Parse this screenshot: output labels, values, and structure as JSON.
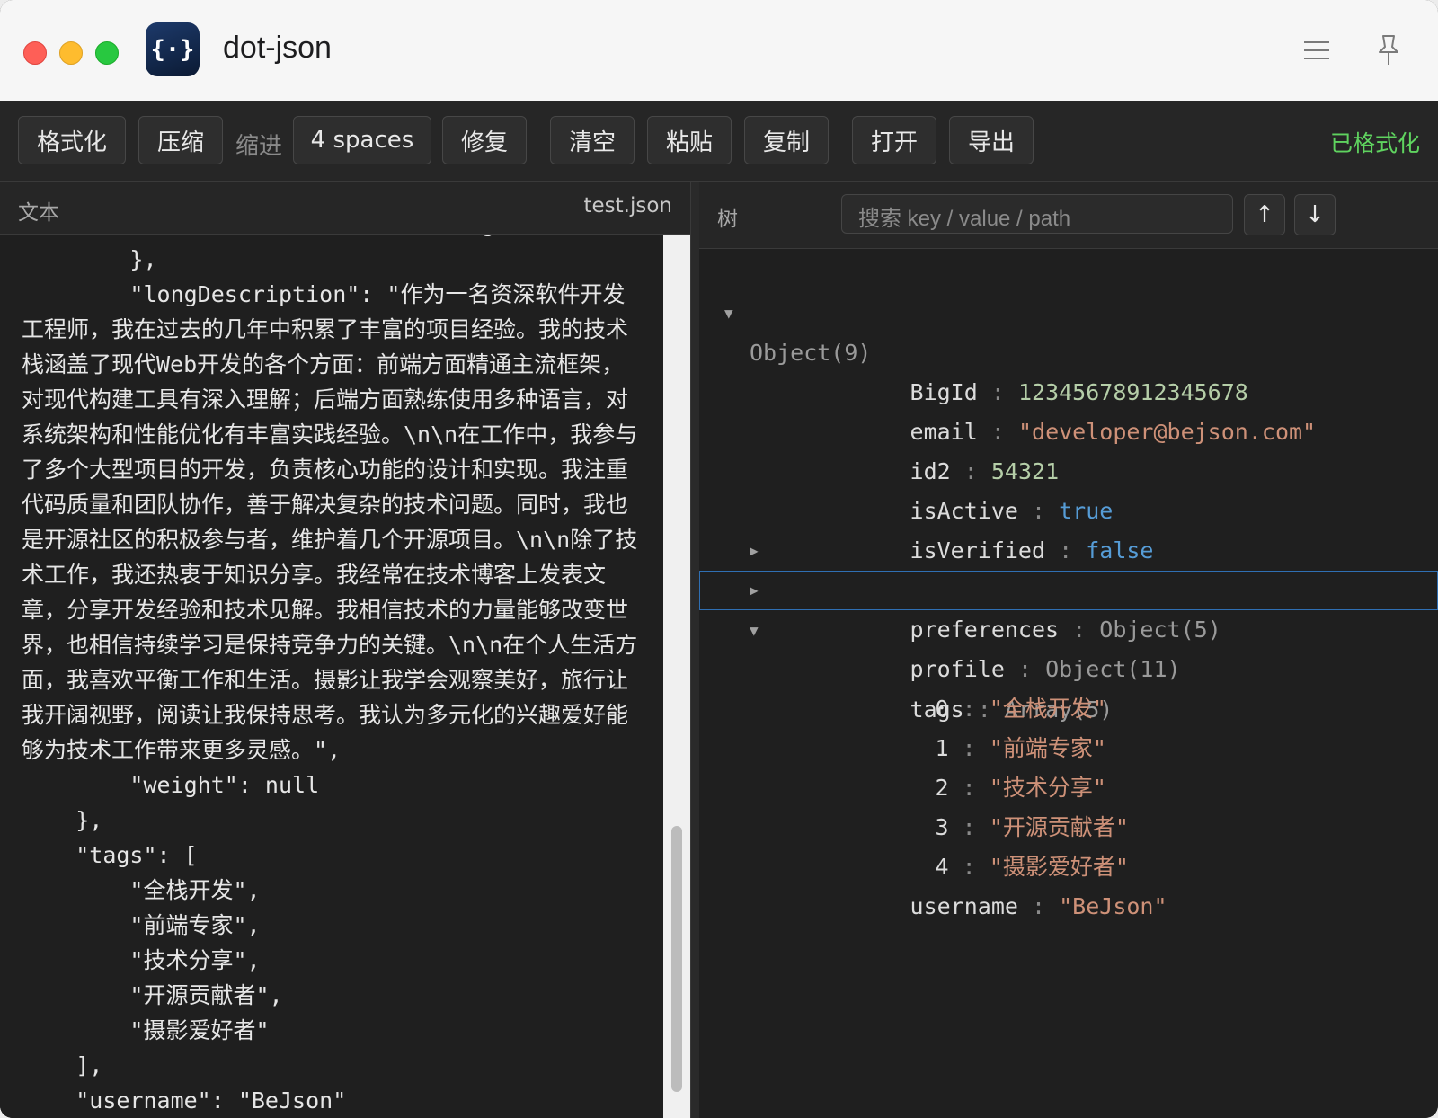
{
  "window": {
    "title": "dot-json",
    "app_icon_text": "{·}"
  },
  "toolbar": {
    "format_label": "格式化",
    "minify_label": "压缩",
    "indent_label": "缩进",
    "indent_value": "4 spaces",
    "repair_label": "修复",
    "clear_label": "清空",
    "paste_label": "粘贴",
    "copy_label": "复制",
    "open_label": "打开",
    "export_label": "导出",
    "status": "已格式化"
  },
  "left_pane": {
    "label": "文本",
    "filename": "test.json",
    "text": "            \"timezone\": \"Asia/Shanghai\"\n        },\n        \"longDescription\": \"作为一名资深软件开发工程师，我在过去的几年中积累了丰富的项目经验。我的技术栈涵盖了现代Web开发的各个方面：前端方面精通主流框架，对现代构建工具有深入理解；后端方面熟练使用多种语言，对系统架构和性能优化有丰富实践经验。\\n\\n在工作中，我参与了多个大型项目的开发，负责核心功能的设计和实现。我注重代码质量和团队协作，善于解决复杂的技术问题。同时，我也是开源社区的积极参与者，维护着几个开源项目。\\n\\n除了技术工作，我还热衷于知识分享。我经常在技术博客上发表文章，分享开发经验和技术见解。我相信技术的力量能够改变世界，也相信持续学习是保持竞争力的关键。\\n\\n在个人生活方面，我喜欢平衡工作和生活。摄影让我学会观察美好，旅行让我开阔视野，阅读让我保持思考。我认为多元化的兴趣爱好能够为技术工作带来更多灵感。\",\n        \"weight\": null\n    },\n    \"tags\": [\n        \"全栈开发\",\n        \"前端专家\",\n        \"技术分享\",\n        \"开源贡献者\",\n        \"摄影爱好者\"\n    ],\n    \"username\": \"BeJson\""
  },
  "right_pane": {
    "label": "树",
    "search_placeholder": "搜索 key / value / path",
    "up_label": "↑",
    "down_label": "↓",
    "root": {
      "label": "Object(9)",
      "expanded": true
    },
    "rows": {
      "bigid": {
        "key": "BigId",
        "value": "12345678912345678"
      },
      "email": {
        "key": "email",
        "value": "\"developer@bejson.com\""
      },
      "id2": {
        "key": "id2",
        "value": "54321"
      },
      "isactive": {
        "key": "isActive",
        "value": "true"
      },
      "isverified": {
        "key": "isVerified",
        "value": "false"
      },
      "preferences": {
        "key": "preferences",
        "value": "Object(5)",
        "expanded": false
      },
      "profile": {
        "key": "profile",
        "value": "Object(11)",
        "expanded": false
      },
      "tags": {
        "key": "tags",
        "value": "Array(5)",
        "expanded": true,
        "selected": true
      },
      "username": {
        "key": "username",
        "value": "\"BeJson\""
      }
    },
    "tag_items": [
      {
        "index": "0",
        "value": "\"全栈开发\""
      },
      {
        "index": "1",
        "value": "\"前端专家\""
      },
      {
        "index": "2",
        "value": "\"技术分享\""
      },
      {
        "index": "3",
        "value": "\"开源贡献者\""
      },
      {
        "index": "4",
        "value": "\"摄影爱好者\""
      }
    ],
    "separator": ":"
  },
  "colors": {
    "number": "#b5cea8",
    "string": "#ce9178",
    "boolean": "#569cd6",
    "status": "#5fd35f",
    "selection": "#2f6fb3"
  },
  "icons": [
    "app-logo-icon",
    "menu-icon",
    "pin-icon",
    "expand-arrow-icon",
    "collapse-arrow-icon",
    "arrow-up-icon",
    "arrow-down-icon"
  ]
}
